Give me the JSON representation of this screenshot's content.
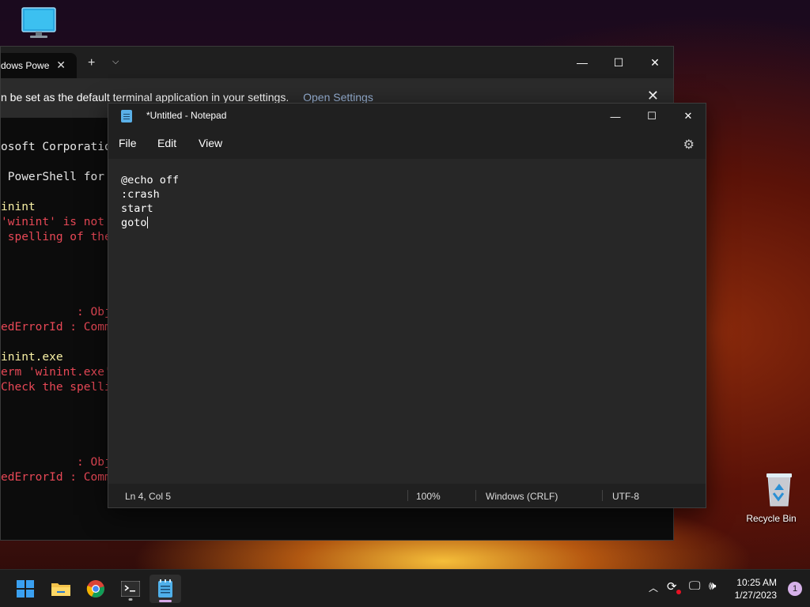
{
  "desktop": {
    "recycle_bin_label": "Recycle Bin"
  },
  "terminal": {
    "tab_title": "dows Powe",
    "infobar_text": "n be set as the default terminal application in your settings.",
    "infobar_link": "Open Settings",
    "lines": [
      {
        "text": "osoft Corporatio",
        "color": "white"
      },
      {
        "text": " PowerShell for",
        "color": "white"
      },
      {
        "text": "inint",
        "color": "yellow"
      },
      {
        "text": "'winint' is not",
        "color": "red"
      },
      {
        "text": " spelling of the",
        "color": "red"
      },
      {
        "text": "           : Obje",
        "color": "red"
      },
      {
        "text": "edErrorId : Comm",
        "color": "red"
      },
      {
        "text": "inint.exe",
        "color": "yellow"
      },
      {
        "text": "erm 'winint.exe'",
        "color": "red"
      },
      {
        "text": "Check the spelli",
        "color": "red"
      },
      {
        "text": "           : Obje",
        "color": "red"
      },
      {
        "text": "edErrorId : Comm",
        "color": "red"
      }
    ]
  },
  "notepad": {
    "title": "*Untitled - Notepad",
    "menu": [
      "File",
      "Edit",
      "View"
    ],
    "content_lines": [
      "@echo off",
      ":crash",
      "start",
      "goto"
    ],
    "status": {
      "position": "Ln 4, Col 5",
      "zoom": "100%",
      "line_ending": "Windows (CRLF)",
      "encoding": "UTF-8"
    }
  },
  "taskbar": {
    "time": "10:25 AM",
    "date": "1/27/2023",
    "notification_count": "1"
  }
}
